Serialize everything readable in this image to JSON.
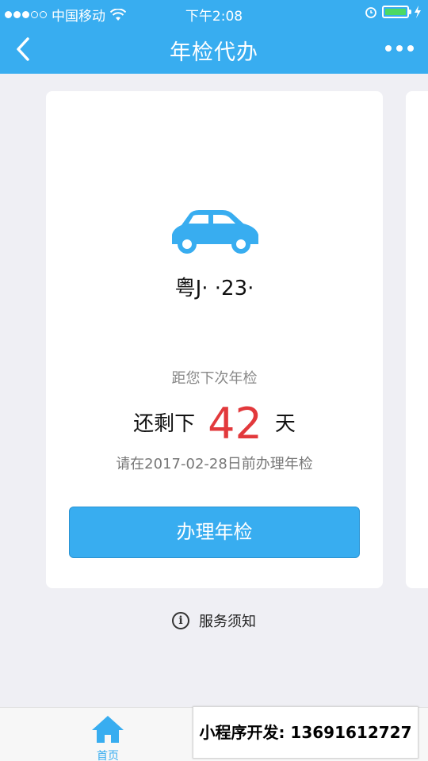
{
  "status_bar": {
    "carrier": "中国移动",
    "time": "下午2:08",
    "icons": [
      "signal-dots-icon",
      "wifi-icon",
      "alarm-icon",
      "battery-icon",
      "charging-icon"
    ]
  },
  "nav": {
    "title": "年检代办",
    "back_icon": "chevron-left-icon",
    "more_icon": "more-dots-icon"
  },
  "card": {
    "icon": "car-icon",
    "plate": "粤J·  ·23·",
    "until_label": "距您下次年检",
    "remain_prefix": "还剩下",
    "remain_days": "42",
    "remain_suffix": "天",
    "deadline_text": "请在2017-02-28日前办理年检",
    "action_button": "办理年检"
  },
  "notice": {
    "icon": "info-icon",
    "label": "服务须知"
  },
  "tabbar": {
    "home_label": "首页",
    "home_icon": "home-icon"
  },
  "watermark": "小程序开发: 13691612727",
  "colors": {
    "brand": "#38adf0",
    "highlight_number": "#e2393c",
    "background": "#efeff4"
  }
}
